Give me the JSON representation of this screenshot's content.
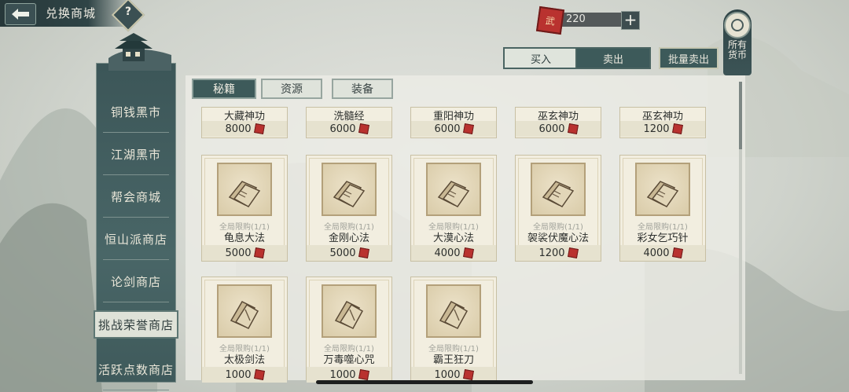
{
  "header": {
    "title": "兑换商城",
    "help_label": "?"
  },
  "currency": {
    "icon_label": "武",
    "value": "220",
    "add_label": "+",
    "all_currency_label": "所有货币"
  },
  "trade_tabs": {
    "buy": "买入",
    "sell": "卖出",
    "bulk_sell": "批量卖出"
  },
  "sidebar": {
    "items": [
      {
        "label": "铜钱黑市"
      },
      {
        "label": "江湖黑市"
      },
      {
        "label": "帮会商城"
      },
      {
        "label": "恒山派商店"
      },
      {
        "label": "论剑商店"
      },
      {
        "label": "挑战荣誉商店"
      },
      {
        "label": "活跃点数商店"
      }
    ],
    "active_index": 5
  },
  "tabs": [
    {
      "label": "秘籍",
      "active": true
    },
    {
      "label": "资源",
      "active": false
    },
    {
      "label": "装备",
      "active": false
    }
  ],
  "items_row0": [
    {
      "name": "大藏神功",
      "price": "8000"
    },
    {
      "name": "洗髓经",
      "price": "6000"
    },
    {
      "name": "重阳神功",
      "price": "6000"
    },
    {
      "name": "巫玄神功",
      "price": "6000"
    },
    {
      "name": "巫玄神功",
      "price": "1200"
    }
  ],
  "items_row1": [
    {
      "limit": "全局限购(1/1)",
      "name": "龟息大法",
      "price": "5000"
    },
    {
      "limit": "全局限购(1/1)",
      "name": "金刚心法",
      "price": "5000"
    },
    {
      "limit": "全局限购(1/1)",
      "name": "大漠心法",
      "price": "4000"
    },
    {
      "limit": "全局限购(1/1)",
      "name": "袈裟伏魔心法",
      "price": "1200"
    },
    {
      "limit": "全局限购(1/1)",
      "name": "彩女乞巧针",
      "price": "4000"
    }
  ],
  "items_row2": [
    {
      "limit": "全局限购(1/1)",
      "name": "太极剑法",
      "price": "1000"
    },
    {
      "limit": "全局限购(1/1)",
      "name": "万毒噬心咒",
      "price": "1000"
    },
    {
      "limit": "全局限购(1/1)",
      "name": "霸王狂刀",
      "price": "1000"
    }
  ],
  "colors": {
    "accent_dark": "#3d5a5a",
    "panel": "#ecece6",
    "currency_red": "#b9322f"
  }
}
